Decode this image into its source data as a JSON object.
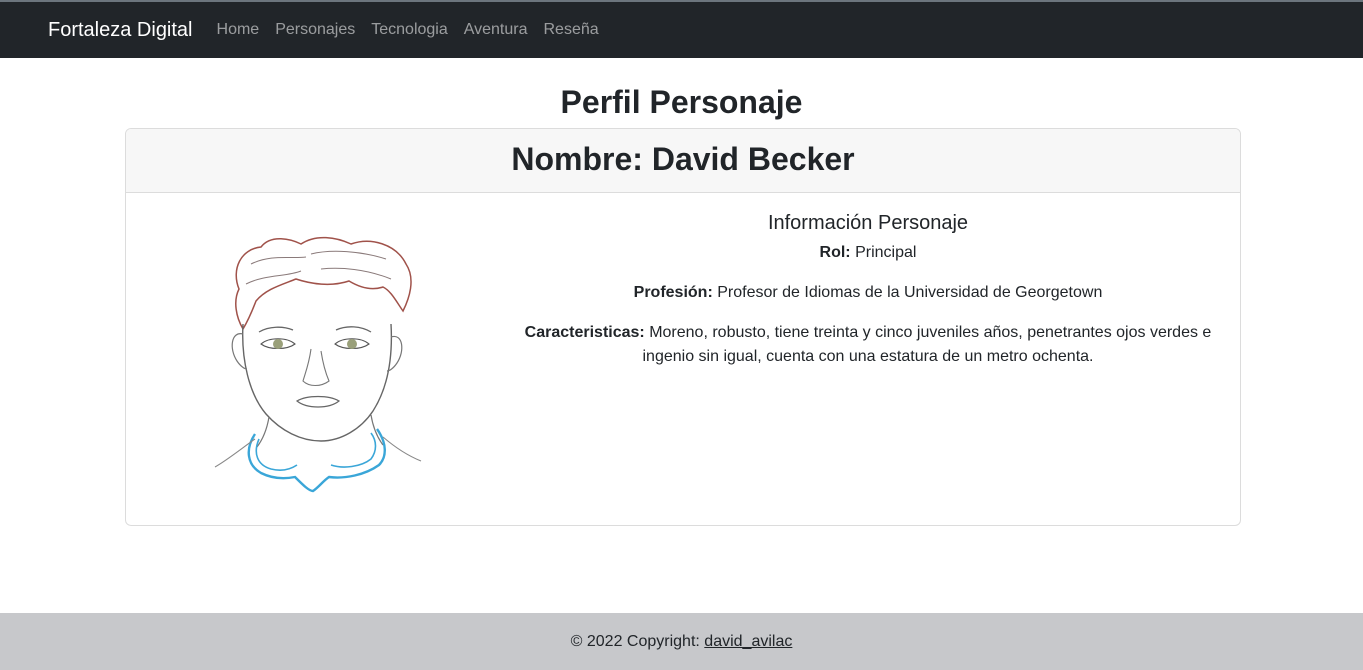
{
  "navbar": {
    "brand": "Fortaleza Digital",
    "links": [
      "Home",
      "Personajes",
      "Tecnologia",
      "Aventura",
      "Reseña"
    ]
  },
  "page": {
    "title": "Perfil Personaje"
  },
  "card": {
    "header": "Nombre: David Becker",
    "info_title": "Información Personaje",
    "rol_label": "Rol:",
    "rol_value": "Principal",
    "profesion_label": "Profesión:",
    "profesion_value": "Profesor de Idiomas de la Universidad de Georgetown",
    "caracteristicas_label": "Caracteristicas:",
    "caracteristicas_value": "Moreno, robusto, tiene treinta y cinco juveniles años, penetrantes ojos verdes e ingenio sin igual, cuenta con una estatura de un metro ochenta."
  },
  "footer": {
    "copyright": "© 2022 Copyright:",
    "author_link": "david_avilac"
  },
  "colors": {
    "navbar_bg": "#212529",
    "footer_bg": "#c7c8cb",
    "hair": "#a0524a",
    "eyes": "#9aa07a",
    "collar": "#3aa6d8"
  }
}
